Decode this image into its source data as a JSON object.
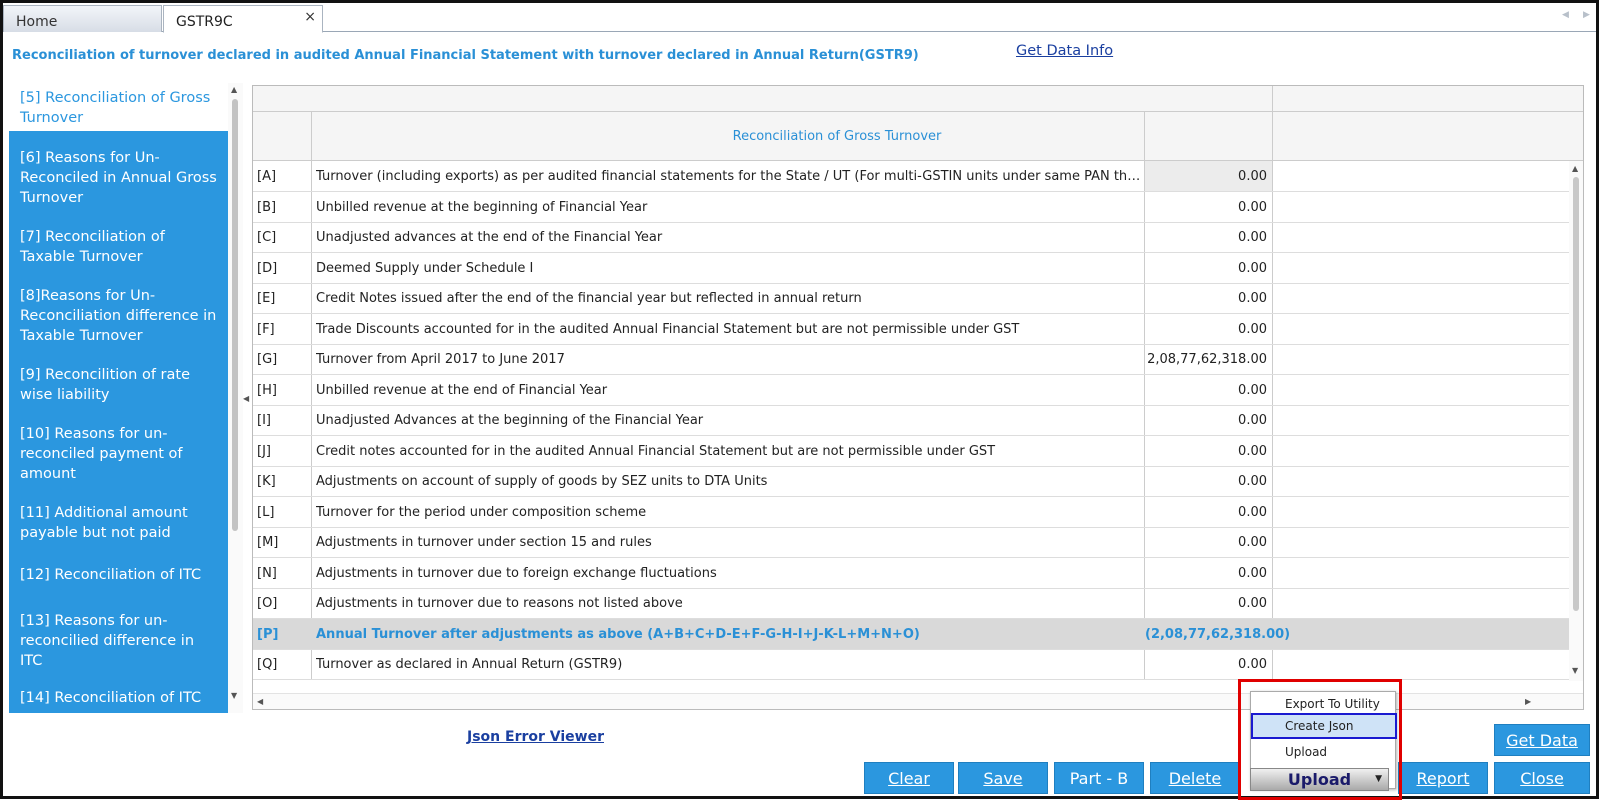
{
  "tabs": {
    "home": "Home",
    "active": "GSTR9C",
    "close": "×"
  },
  "heading": "Reconciliation of turnover declared in audited Annual Financial Statement with turnover declared in Annual Return(GSTR9)",
  "get_data_info": "Get Data Info",
  "sidebar": [
    "[5] Reconciliation of Gross Turnover",
    "[6] Reasons for Un-Reconciled in Annual Gross Turnover",
    "[7] Reconciliation of Taxable Turnover",
    "[8]Reasons for Un-Reconciliation difference in Taxable Turnover",
    "[9] Reconcilition of rate wise liability",
    "[10] Reasons for un-reconciled payment of amount",
    "[11] Additional amount payable but not paid",
    "[12] Reconciliation of ITC",
    "[13] Reasons for un-reconcilied difference in ITC",
    "[14] Reconciliation of ITC"
  ],
  "grid_title": "Reconciliation of Gross Turnover",
  "rows": [
    {
      "code": "[A]",
      "desc": "Turnover (including exports) as per audited financial statements for the State / UT (For multi-GSTIN units under same PAN the turnover shall be...",
      "value": "0.00"
    },
    {
      "code": "[B]",
      "desc": "Unbilled revenue at the beginning of Financial Year",
      "value": "0.00"
    },
    {
      "code": "[C]",
      "desc": "Unadjusted advances at the end of the Financial Year",
      "value": "0.00"
    },
    {
      "code": "[D]",
      "desc": "Deemed Supply under Schedule I",
      "value": "0.00"
    },
    {
      "code": "[E]",
      "desc": "Credit Notes issued after the end of the financial year but reflected in annual return",
      "value": "0.00"
    },
    {
      "code": "[F]",
      "desc": "Trade Discounts accounted for in the audited Annual Financial Statement but are not permissible under GST",
      "value": "0.00"
    },
    {
      "code": "[G]",
      "desc": "Turnover from April 2017 to June 2017",
      "value": "2,08,77,62,318.00"
    },
    {
      "code": "[H]",
      "desc": "Unbilled revenue at the end of Financial Year",
      "value": "0.00"
    },
    {
      "code": "[I]",
      "desc": "Unadjusted Advances at the beginning of the Financial Year",
      "value": "0.00"
    },
    {
      "code": "[J]",
      "desc": "Credit notes accounted for in the audited Annual Financial Statement but are not permissible under GST",
      "value": "0.00"
    },
    {
      "code": "[K]",
      "desc": "Adjustments on account of supply of goods by SEZ units to DTA Units",
      "value": "0.00"
    },
    {
      "code": "[L]",
      "desc": "Turnover for the period under composition scheme",
      "value": "0.00"
    },
    {
      "code": "[M]",
      "desc": "Adjustments in turnover under section 15 and rules",
      "value": "0.00"
    },
    {
      "code": "[N]",
      "desc": "Adjustments in turnover due to foreign exchange fluctuations",
      "value": "0.00"
    },
    {
      "code": "[O]",
      "desc": "Adjustments in turnover due to reasons not listed above",
      "value": "0.00"
    },
    {
      "code": "[P]",
      "desc": "Annual Turnover after adjustments as above (A+B+C+D-E+F-G-H-I+J-K-L+M+N+O)",
      "value": "(2,08,77,62,318.00)"
    },
    {
      "code": "[Q]",
      "desc": "Turnover as declared in Annual Return (GSTR9)",
      "value": "0.00"
    }
  ],
  "json_error_viewer": "Json Error Viewer",
  "buttons": {
    "get_data": "Get Data",
    "clear": "Clear",
    "save": "Save",
    "part_b": "Part - B",
    "delete": "Delete",
    "upload": "Upload",
    "report": "Report",
    "close": "Close"
  },
  "upload_menu": [
    "Export To Utility",
    "Create Json",
    "Upload"
  ]
}
